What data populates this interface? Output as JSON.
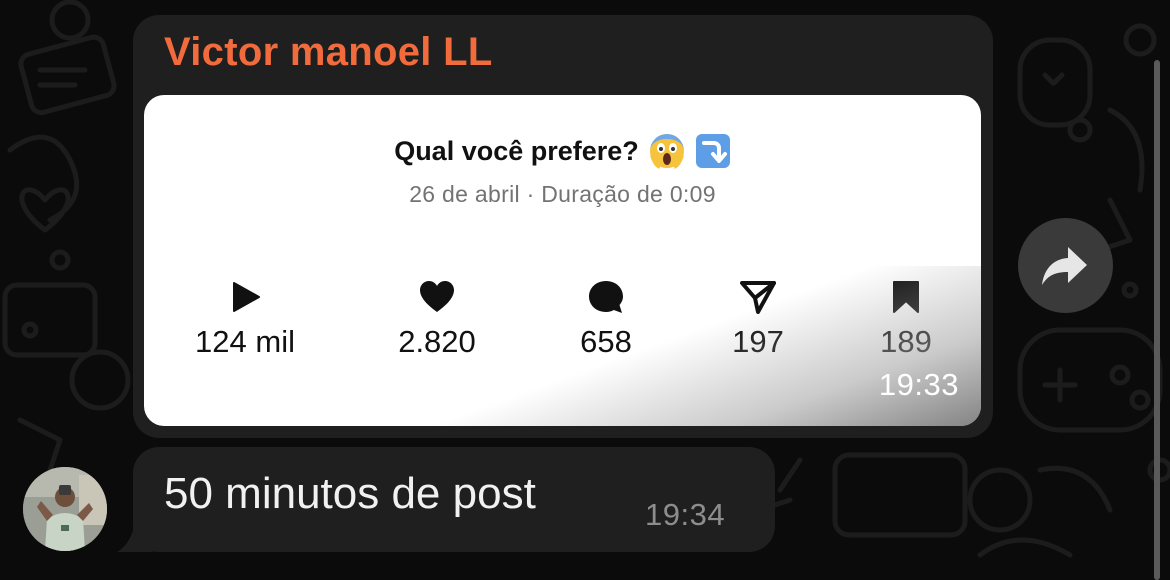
{
  "message": {
    "sender": "Victor manoel LL",
    "sender_color": "#f16b3c"
  },
  "post": {
    "title": "Qual você prefere?",
    "title_emojis": [
      "face-screaming-in-fear-icon",
      "arrow-curving-down-icon"
    ],
    "meta": "26 de abril · Duração de 0:09",
    "stats": [
      {
        "icon": "play-icon",
        "value": "124 mil"
      },
      {
        "icon": "heart-icon",
        "value": "2.820"
      },
      {
        "icon": "comment-icon",
        "value": "658"
      },
      {
        "icon": "send-icon",
        "value": "197"
      },
      {
        "icon": "bookmark-icon",
        "value": "189"
      }
    ],
    "time": "19:33"
  },
  "reply": {
    "text": "50 minutos de post",
    "time": "19:34"
  },
  "colors": {
    "background": "#0b0b0b",
    "bubble": "#1f1f1f",
    "share_button": "#3a3a3a"
  }
}
